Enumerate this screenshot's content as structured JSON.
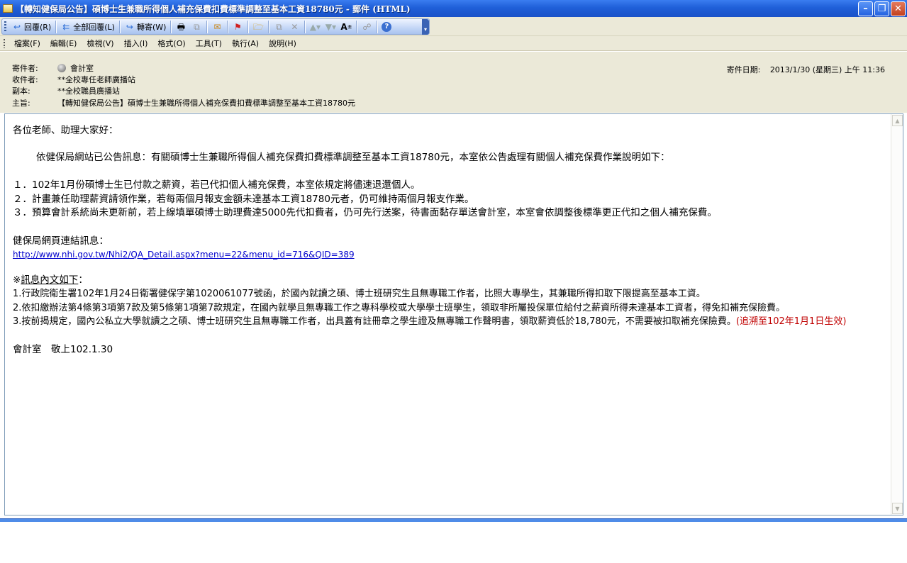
{
  "window": {
    "title": "【轉知健保局公告】碩博士生兼職所得個人補充保費扣費標準調整至基本工資18780元 - 郵件 (HTML)"
  },
  "toolbar": {
    "reply": "回覆(R)",
    "reply_all": "全部回覆(L)",
    "forward": "轉寄(W)"
  },
  "menu": [
    "檔案(F)",
    "編輯(E)",
    "檢視(V)",
    "插入(I)",
    "格式(O)",
    "工具(T)",
    "執行(A)",
    "說明(H)"
  ],
  "header": {
    "from_label": "寄件者:",
    "from": "會計室",
    "to_label": "收件者:",
    "to": "**全校專任老師廣播站",
    "cc_label": "副本:",
    "cc": "**全校職員廣播站",
    "subject_label": "主旨:",
    "subject": "【轉知健保局公告】碩博士生兼職所得個人補充保費扣費標準調整至基本工資18780元",
    "date_label": "寄件日期:",
    "date": "2013/1/30 (星期三) 上午 11:36"
  },
  "body": {
    "greeting": "各位老師、助理大家好：",
    "intro": "依健保局網站已公告訊息：有關碩博士生兼職所得個人補充保費扣費標準調整至基本工資18780元，本室依公告處理有關個人補充保費作業說明如下：",
    "items": [
      "１．102年1月份碩博士生已付款之薪資，若已代扣個人補充保費，本室依規定將儘速退還個人。",
      "２．計畫兼任助理薪資請領作業，若每兩個月報支金額未達基本工資18780元者，仍可維持兩個月報支作業。",
      "３．預算會計系統尚未更新前，若上線填單碩博士助理費達5000先代扣費者，仍可先行送案，待書面黏存單送會計室，本室會依調整後標準更正代扣之個人補充保費。"
    ],
    "link_heading": "健保局網頁連結訊息：",
    "link_url": "http://www.nhi.gov.tw/Nhi2/QA_Detail.aspx?menu=22&menu_id=716&QID=389",
    "notice_prefix": "※",
    "notice_heading": "訊息內文如下",
    "notice_colon": "：",
    "notices": [
      "1.行政院衛生署102年1月24日衛署健保字第1020061077號函，於國內就讀之碩、博士班研究生且無專職工作者，比照大專學生，其兼職所得扣取下限提高至基本工資。",
      "2.依扣繳辦法第4條第3項第7款及第5條第1項第7款規定，在國內就學且無專職工作之專科學校或大學學士班學生，領取非所屬投保單位給付之薪資所得未達基本工資者，得免扣補充保險費。",
      "3.按前揭規定，國內公私立大學就讀之之碩、博士班研究生且無專職工作者，出具蓋有註冊章之學生證及無專職工作聲明書，領取薪資低於18,780元，不需要被扣取補充保險費。"
    ],
    "notice_red": "(追溯至102年1月1日生效)",
    "signature": "會計室　敬上102.1.30"
  }
}
